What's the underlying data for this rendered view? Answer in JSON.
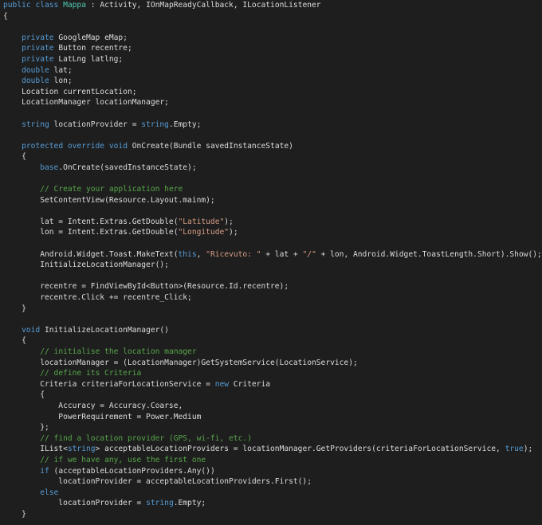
{
  "colors": {
    "background": "#1e1e1e",
    "plain": "#dcdcdc",
    "keyword": "#569cd6",
    "type": "#4ec9b0",
    "string": "#d69d85",
    "comment": "#57a64a"
  },
  "code": {
    "lines": [
      [
        [
          "k",
          "public"
        ],
        [
          "p",
          " "
        ],
        [
          "k",
          "class"
        ],
        [
          "p",
          " "
        ],
        [
          "t",
          "Mappa"
        ],
        [
          "p",
          " : Activity, IOnMapReadyCallback, ILocationListener"
        ]
      ],
      [
        [
          "p",
          "{"
        ]
      ],
      [],
      [
        [
          "p",
          "    "
        ],
        [
          "k",
          "private"
        ],
        [
          "p",
          " GoogleMap eMap;"
        ]
      ],
      [
        [
          "p",
          "    "
        ],
        [
          "k",
          "private"
        ],
        [
          "p",
          " Button recentre;"
        ]
      ],
      [
        [
          "p",
          "    "
        ],
        [
          "k",
          "private"
        ],
        [
          "p",
          " LatLng latlng;"
        ]
      ],
      [
        [
          "p",
          "    "
        ],
        [
          "k",
          "double"
        ],
        [
          "p",
          " lat;"
        ]
      ],
      [
        [
          "p",
          "    "
        ],
        [
          "k",
          "double"
        ],
        [
          "p",
          " lon;"
        ]
      ],
      [
        [
          "p",
          "    Location currentLocation;"
        ]
      ],
      [
        [
          "p",
          "    LocationManager locationManager;"
        ]
      ],
      [],
      [
        [
          "p",
          "    "
        ],
        [
          "k",
          "string"
        ],
        [
          "p",
          " locationProvider = "
        ],
        [
          "k",
          "string"
        ],
        [
          "p",
          ".Empty;"
        ]
      ],
      [],
      [
        [
          "p",
          "    "
        ],
        [
          "k",
          "protected"
        ],
        [
          "p",
          " "
        ],
        [
          "k",
          "override"
        ],
        [
          "p",
          " "
        ],
        [
          "k",
          "void"
        ],
        [
          "p",
          " OnCreate(Bundle savedInstanceState)"
        ]
      ],
      [
        [
          "p",
          "    {"
        ]
      ],
      [
        [
          "p",
          "        "
        ],
        [
          "k",
          "base"
        ],
        [
          "p",
          ".OnCreate(savedInstanceState);"
        ]
      ],
      [],
      [
        [
          "p",
          "        "
        ],
        [
          "c",
          "// Create your application here"
        ]
      ],
      [
        [
          "p",
          "        SetContentView(Resource.Layout.mainm);"
        ]
      ],
      [],
      [
        [
          "p",
          "        lat = Intent.Extras.GetDouble("
        ],
        [
          "s",
          "\"Latitude\""
        ],
        [
          "p",
          ");"
        ]
      ],
      [
        [
          "p",
          "        lon = Intent.Extras.GetDouble("
        ],
        [
          "s",
          "\"Longitude\""
        ],
        [
          "p",
          ");"
        ]
      ],
      [],
      [
        [
          "p",
          "        Android.Widget.Toast.MakeText("
        ],
        [
          "k",
          "this"
        ],
        [
          "p",
          ", "
        ],
        [
          "s",
          "\"Ricevuto: \""
        ],
        [
          "p",
          " + lat + "
        ],
        [
          "s",
          "\"/\""
        ],
        [
          "p",
          " + lon, Android.Widget.ToastLength.Short).Show();"
        ]
      ],
      [
        [
          "p",
          "        InitializeLocationManager();"
        ]
      ],
      [],
      [
        [
          "p",
          "        recentre = FindViewById<Button>(Resource.Id.recentre);"
        ]
      ],
      [
        [
          "p",
          "        recentre.Click += recentre_Click;"
        ]
      ],
      [
        [
          "p",
          "    }"
        ]
      ],
      [],
      [
        [
          "p",
          "    "
        ],
        [
          "k",
          "void"
        ],
        [
          "p",
          " InitializeLocationManager()"
        ]
      ],
      [
        [
          "p",
          "    {"
        ]
      ],
      [
        [
          "p",
          "        "
        ],
        [
          "c",
          "// initialise the location manager"
        ]
      ],
      [
        [
          "p",
          "        locationManager = (LocationManager)GetSystemService(LocationService);"
        ]
      ],
      [
        [
          "p",
          "        "
        ],
        [
          "c",
          "// define its Criteria"
        ]
      ],
      [
        [
          "p",
          "        Criteria criteriaForLocationService = "
        ],
        [
          "k",
          "new"
        ],
        [
          "p",
          " Criteria"
        ]
      ],
      [
        [
          "p",
          "        {"
        ]
      ],
      [
        [
          "p",
          "            Accuracy = Accuracy.Coarse,"
        ]
      ],
      [
        [
          "p",
          "            PowerRequirement = Power.Medium"
        ]
      ],
      [
        [
          "p",
          "        };"
        ]
      ],
      [
        [
          "p",
          "        "
        ],
        [
          "c",
          "// find a location provider (GPS, wi-fi, etc.)"
        ]
      ],
      [
        [
          "p",
          "        IList<"
        ],
        [
          "k",
          "string"
        ],
        [
          "p",
          "> acceptableLocationProviders = locationManager.GetProviders(criteriaForLocationService, "
        ],
        [
          "k",
          "true"
        ],
        [
          "p",
          ");"
        ]
      ],
      [
        [
          "p",
          "        "
        ],
        [
          "c",
          "// if we have any, use the first one"
        ]
      ],
      [
        [
          "p",
          "        "
        ],
        [
          "k",
          "if"
        ],
        [
          "p",
          " (acceptableLocationProviders.Any())"
        ]
      ],
      [
        [
          "p",
          "            locationProvider = acceptableLocationProviders.First();"
        ]
      ],
      [
        [
          "p",
          "        "
        ],
        [
          "k",
          "else"
        ]
      ],
      [
        [
          "p",
          "            locationProvider = "
        ],
        [
          "k",
          "string"
        ],
        [
          "p",
          ".Empty;"
        ]
      ],
      [
        [
          "p",
          "    }"
        ]
      ]
    ]
  }
}
